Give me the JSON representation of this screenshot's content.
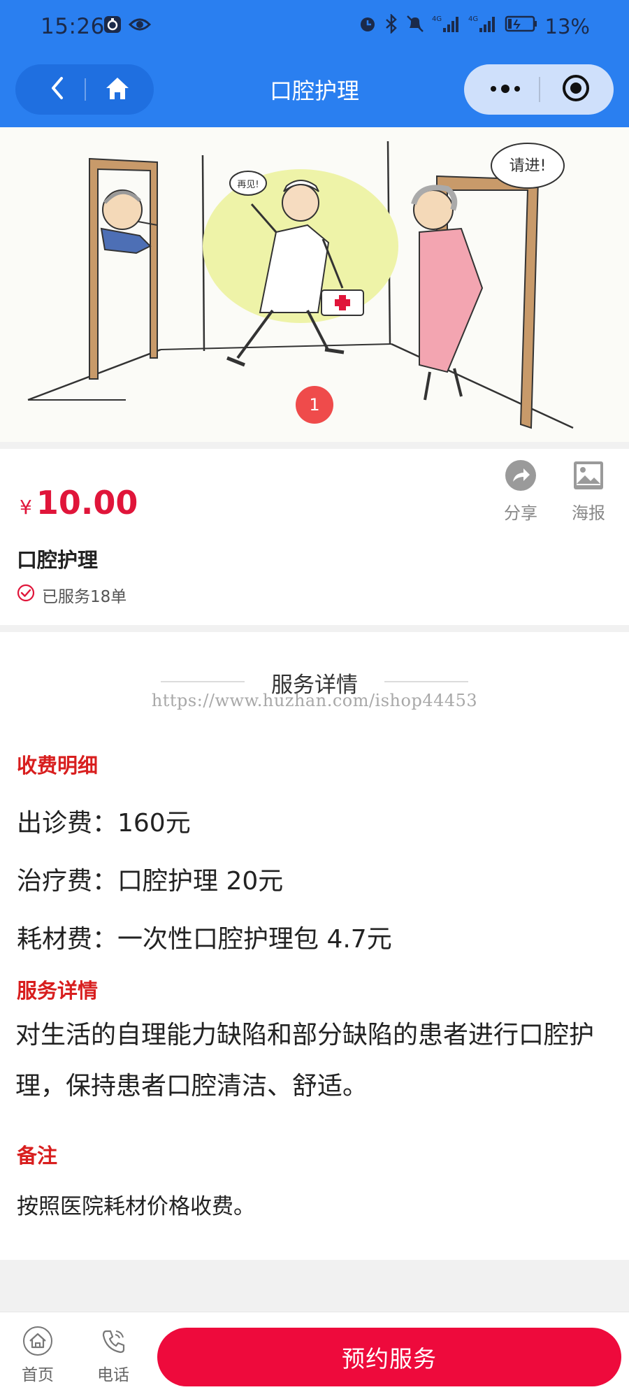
{
  "status_bar": {
    "time": "15:26",
    "battery": "13%"
  },
  "nav": {
    "title": "口腔护理"
  },
  "banner": {
    "indicator": "1",
    "speech_left": "再见!",
    "speech_right": "请进!"
  },
  "product": {
    "currency": "¥",
    "price": "10.00",
    "name": "口腔护理",
    "served": "已服务18单",
    "share_label": "分享",
    "poster_label": "海报"
  },
  "detail": {
    "heading": "服务详情",
    "watermark": "https://www.huzhan.com/ishop44453",
    "fee_title": "收费明细",
    "fees": [
      "出诊费：160元",
      "治疗费：口腔护理 20元",
      "耗材费：一次性口腔护理包 4.7元"
    ],
    "desc_title": "服务详情",
    "desc": "对生活的自理能力缺陷和部分缺陷的患者进行口腔护理，保持患者口腔清洁、舒适。",
    "note_title": "备注",
    "note": "按照医院耗材价格收费。"
  },
  "bottom_bar": {
    "home_label": "首页",
    "phone_label": "电话",
    "book_label": "预约服务"
  },
  "colors": {
    "header_blue": "#2a7ff0",
    "price_red": "#e0153a",
    "section_red": "#d81e1e",
    "button_red": "#ee0a3c"
  }
}
